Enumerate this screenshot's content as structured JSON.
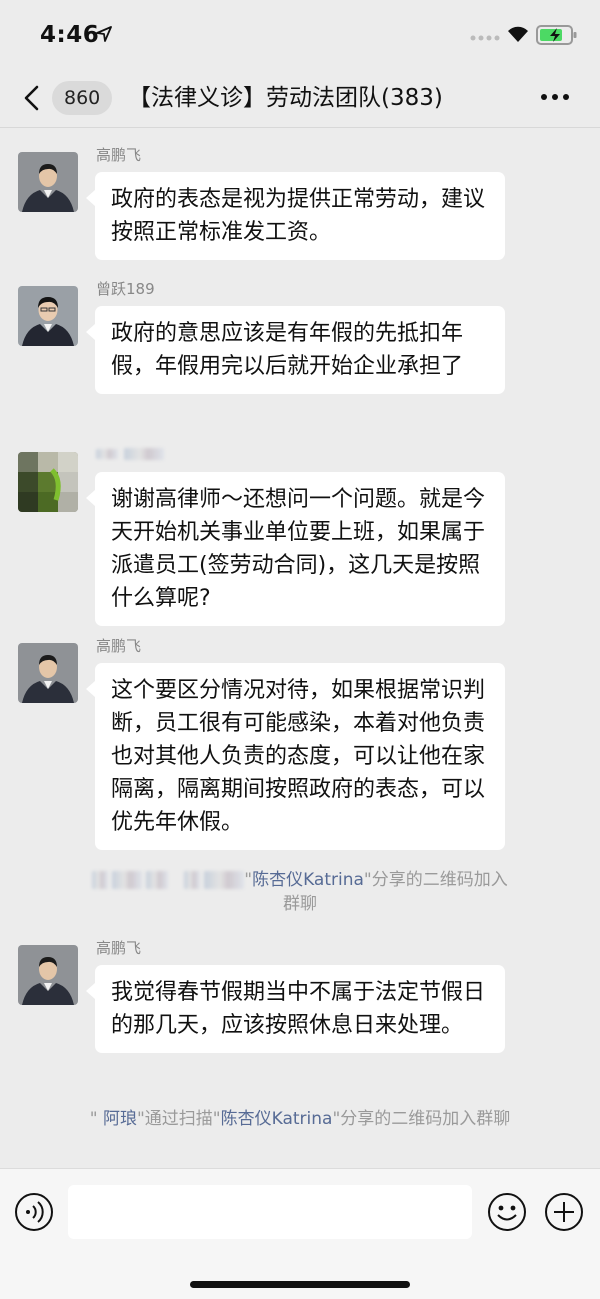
{
  "status_bar": {
    "time": "4:46"
  },
  "nav": {
    "unread_count": "860",
    "title": "【法律义诊】劳动法团队(383)"
  },
  "messages": [
    {
      "sender": "高鹏飞",
      "text": "政府的表态是视为提供正常劳动，建议按照正常标准发工资。"
    },
    {
      "sender": "曾跃189",
      "text": "政府的意思应该是有年假的先抵扣年假，年假用完以后就开始企业承担了"
    },
    {
      "sender": "",
      "text": "谢谢高律师～还想问一个问题。就是今天开始机关事业单位要上班，如果属于派遣员工(签劳动合同)，这几天是按照什么算呢?"
    },
    {
      "sender": "高鹏飞",
      "text": "这个要区分情况对待，如果根据常识判断，员工很有可能感染，本着对他负责也对其他人负责的态度，可以让他在家隔离，隔离期间按照政府的表态，可以优先年休假。"
    },
    {
      "sender": "高鹏飞",
      "text": "我觉得春节假期当中不属于法定节假日的那几天，应该按照休息日来处理。"
    }
  ],
  "system_messages": [
    {
      "prefix": "\"",
      "name": "陈杏仪Katrina",
      "suffix": "\"分享的二维码加入",
      "line2": "群聊"
    },
    {
      "prefix": "\" ",
      "inviter": "阿琅",
      "middle": "\"通过扫描\"",
      "name": "陈杏仪Katrina",
      "suffix": "\"分享的二维码加入群聊"
    }
  ],
  "input": {
    "placeholder": ""
  },
  "colors": {
    "background": "#ececec",
    "bubble": "#ffffff",
    "link_name": "#576b95",
    "meta_text": "#888888"
  }
}
